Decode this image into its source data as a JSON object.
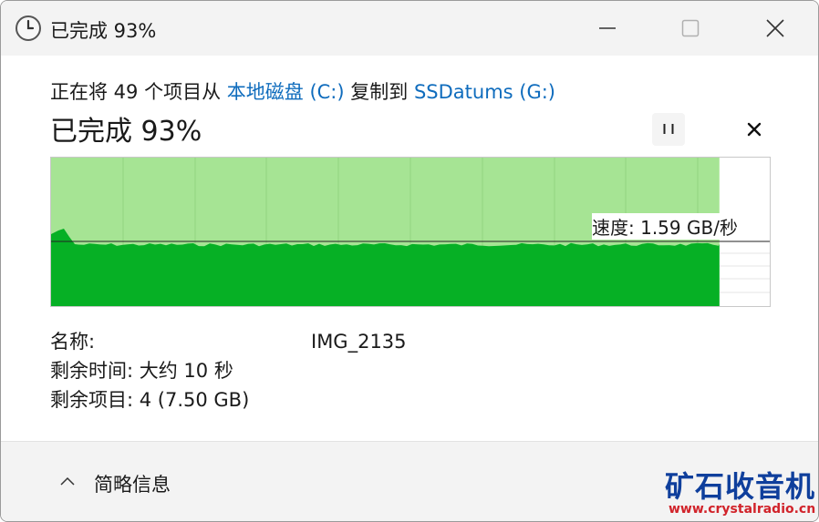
{
  "window": {
    "title": "已完成 93%",
    "icons": {
      "app": "clock-icon",
      "minimize": "minimize-icon",
      "maximize": "maximize-icon",
      "close": "close-icon"
    }
  },
  "copy": {
    "prefix": "正在将 49 个项目从",
    "source": "本地磁盘 (C:)",
    "middle": "复制到",
    "destination": "SSDatums (G:)"
  },
  "status": {
    "text": "已完成 93%",
    "percent": 93,
    "pause_icon": "pause-icon",
    "cancel_icon": "cancel-icon"
  },
  "speed": {
    "label": "速度: 1.59 GB/秒",
    "value": 1.59,
    "unit": "GB/秒"
  },
  "details": {
    "name_label": "名称:",
    "name_value": "IMG_2135",
    "time_left": "剩余时间: 大约 10 秒",
    "items_left": "剩余项目: 4 (7.50 GB)"
  },
  "footer": {
    "label": "简略信息",
    "icon": "chevron-up-icon"
  },
  "watermark": {
    "title": "矿石收音机",
    "url": "www.crystalradio.cn"
  },
  "colors": {
    "progress_fill": "#a6e494",
    "throughput_fill": "#06b025",
    "link": "#0f6cbd"
  }
}
